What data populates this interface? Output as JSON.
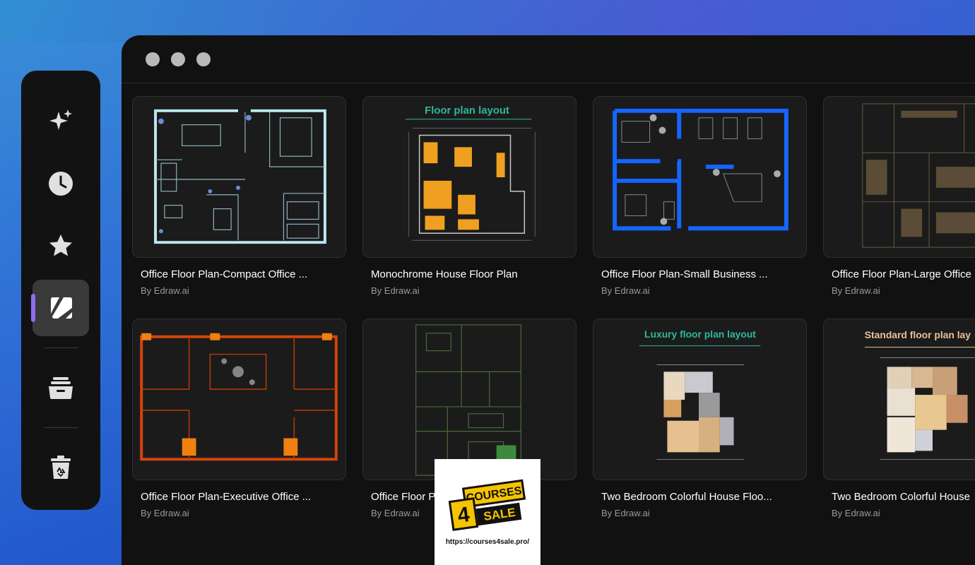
{
  "window": {
    "controls": [
      "close",
      "minimize",
      "maximize"
    ]
  },
  "sidebar": {
    "items": [
      {
        "icon": "sparkle-icon",
        "active": false
      },
      {
        "icon": "clock-icon",
        "active": false
      },
      {
        "icon": "star-icon",
        "active": false
      },
      {
        "icon": "templates-icon",
        "active": true
      },
      {
        "icon": "folder-icon",
        "active": false
      },
      {
        "icon": "recycle-bin-icon",
        "active": false
      }
    ]
  },
  "templates": [
    {
      "title": "Office Floor Plan-Compact Office ...",
      "author": "By Edraw.ai"
    },
    {
      "title": "Monochrome House Floor Plan",
      "author": "By Edraw.ai",
      "thumb_heading": "Floor plan layout"
    },
    {
      "title": "Office Floor Plan-Small Business ...",
      "author": "By Edraw.ai"
    },
    {
      "title": "Office Floor Plan-Large Office",
      "author": "By Edraw.ai"
    },
    {
      "title": "Office Floor Plan-Executive Office ...",
      "author": "By Edraw.ai"
    },
    {
      "title": "Office Floor P",
      "author": "By Edraw.ai"
    },
    {
      "title": "Two Bedroom Colorful House Floo...",
      "author": "By Edraw.ai",
      "thumb_heading": "Luxury floor plan layout"
    },
    {
      "title": "Two Bedroom Colorful House",
      "author": "By Edraw.ai",
      "thumb_heading": "Standard floor plan lay"
    }
  ],
  "watermark": {
    "line1": "COURSES",
    "big": "4",
    "line2": "SALE",
    "url": "https://courses4sale.pro/"
  },
  "colors": {
    "accent": "#8f6cf0",
    "card_bg": "#1b1b1b",
    "window_bg": "#111111"
  }
}
